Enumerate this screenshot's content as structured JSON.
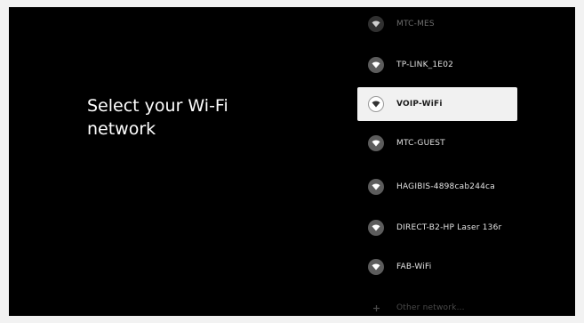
{
  "prompt": {
    "title": "Select your Wi-Fi\nnetwork"
  },
  "networks": [
    {
      "label": "MTC-MES",
      "icon": "wifi-icon"
    },
    {
      "label": "TP-LINK_1E02",
      "icon": "wifi-icon"
    },
    {
      "label": "VOIP-WiFi",
      "icon": "wifi-icon",
      "selected": true
    },
    {
      "label": "MTC-GUEST",
      "icon": "wifi-icon"
    },
    {
      "label": "HAGIBIS-4898cab244ca",
      "icon": "wifi-icon"
    },
    {
      "label": "DIRECT-B2-HP Laser 136r",
      "icon": "wifi-icon"
    },
    {
      "label": "FAB-WiFi",
      "icon": "wifi-icon"
    },
    {
      "label": "Other network...",
      "icon": "plus-icon"
    }
  ],
  "colors": {
    "background": "#000000",
    "selected_row": "#f1f1f1",
    "text": "#e2e2e2"
  }
}
